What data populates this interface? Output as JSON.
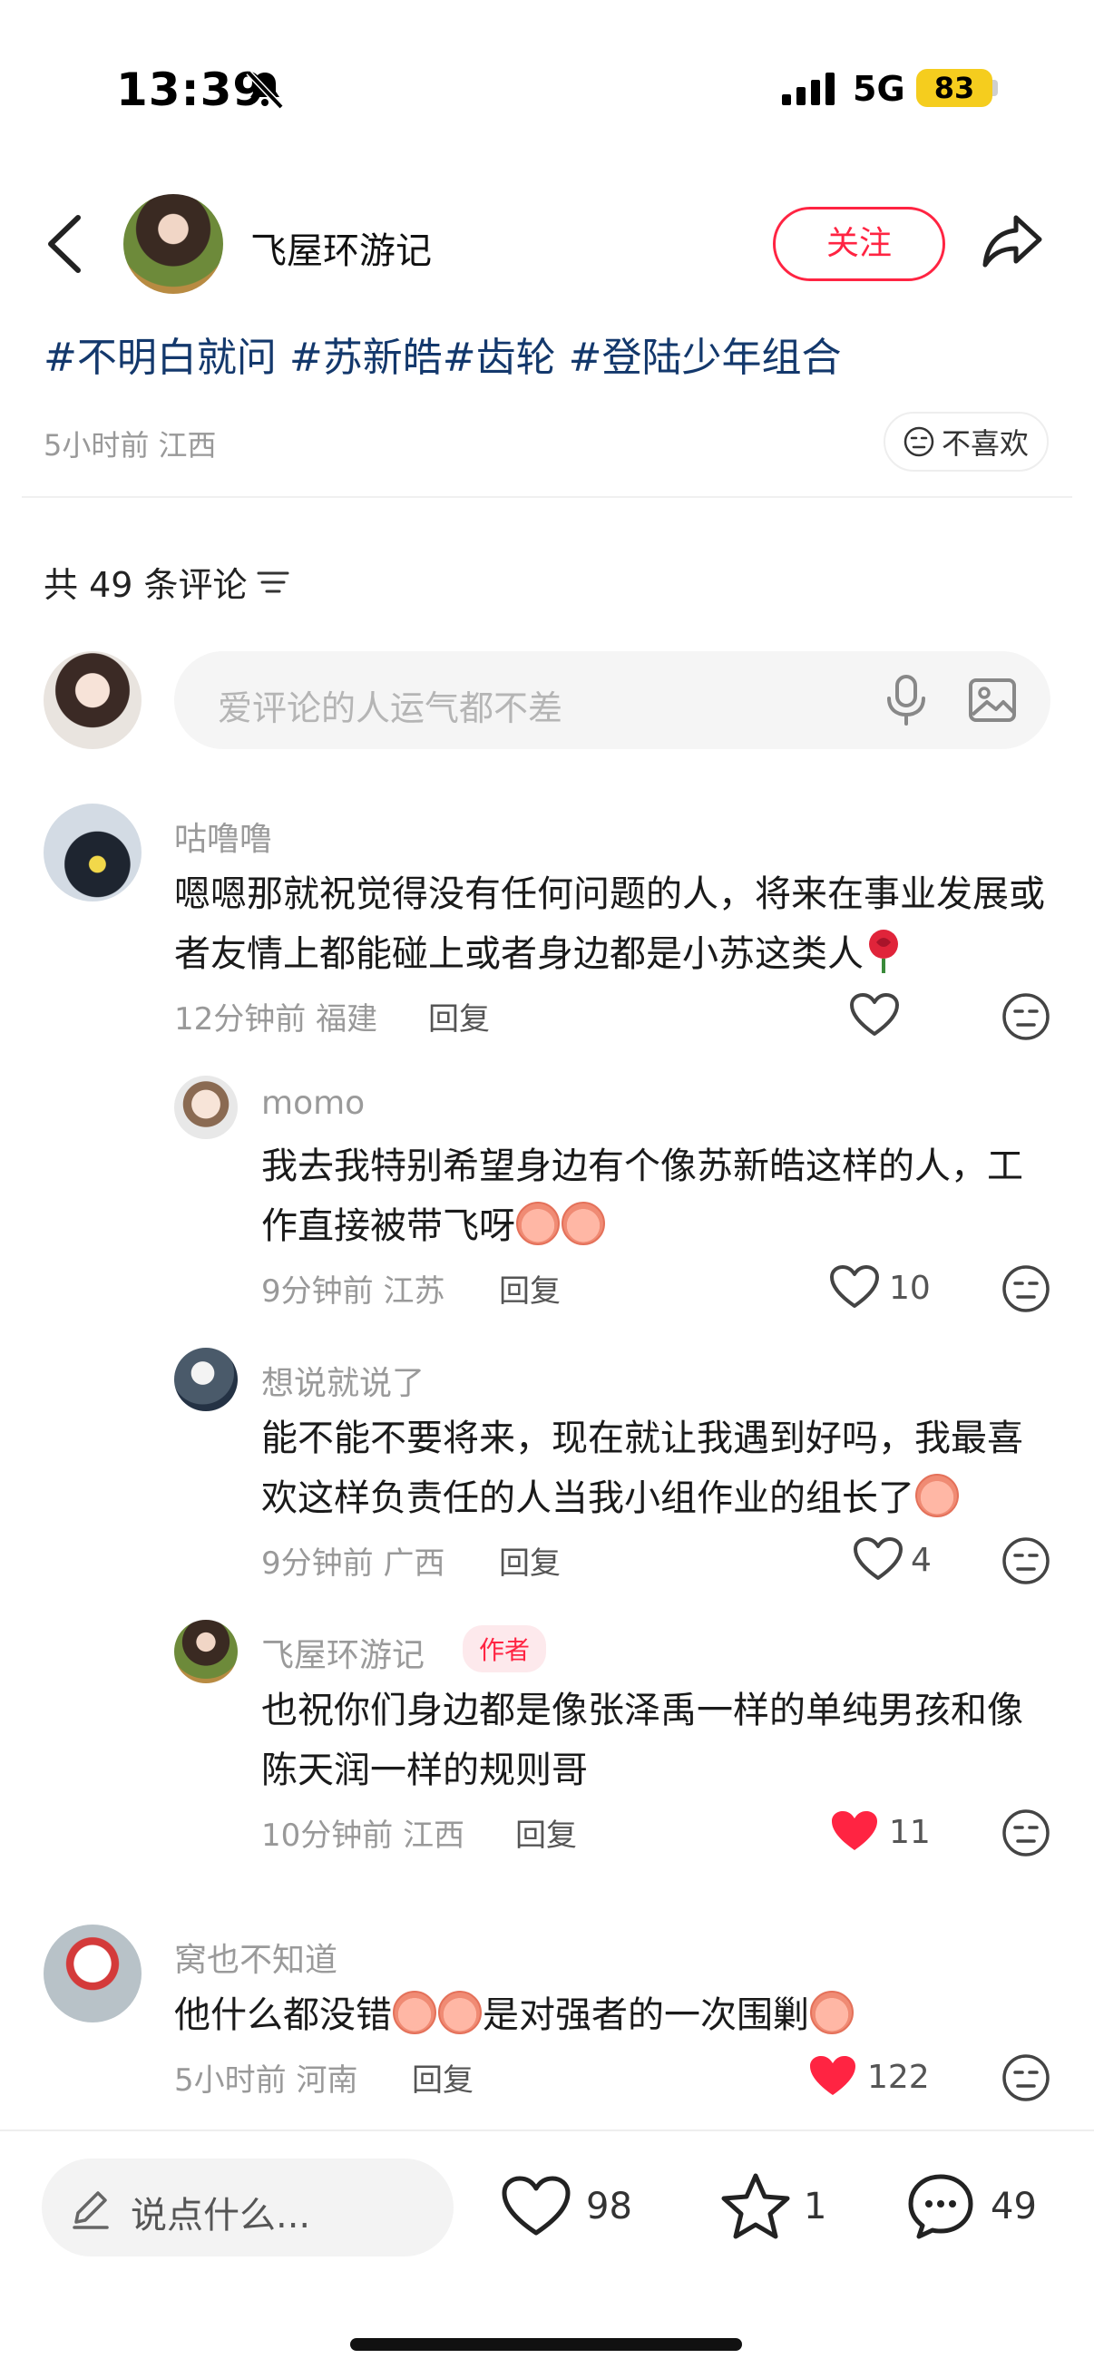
{
  "status_bar": {
    "time": "13:39",
    "network": "5G",
    "battery": "83",
    "battery_color": "#f5cd1e"
  },
  "header": {
    "author": "飞屋环游记",
    "follow_label": "关注"
  },
  "post": {
    "tags": "#不明白就问 #苏新皓#齿轮 #登陆少年组合",
    "meta": "5小时前 江西",
    "dislike_label": "不喜欢"
  },
  "comments_header": {
    "count": "共 49 条评论"
  },
  "comment_input": {
    "placeholder": "爱评论的人运气都不差"
  },
  "comments": [
    {
      "name": "咕噜噜",
      "text": "嗯嗯那就祝觉得没有任何问题的人，将来在事业发展或者友情上都能碰上或者身边都是小苏这类人",
      "meta": "12分钟前 福建",
      "reply": "回复",
      "likes": "",
      "liked": false
    },
    {
      "name": "momo",
      "text": "我去我特别希望身边有个像苏新皓这样的人，工作直接被带飞呀",
      "meta": "9分钟前 江苏",
      "reply": "回复",
      "likes": "10",
      "liked": false
    },
    {
      "name": "想说就说了",
      "text": "能不能不要将来，现在就让我遇到好吗，我最喜欢这样负责任的人当我小组作业的组长了",
      "meta": "9分钟前 广西",
      "reply": "回复",
      "likes": "4",
      "liked": false
    },
    {
      "name": "飞屋环游记",
      "badge": "作者",
      "text": "也祝你们身边都是像张泽禹一样的单纯男孩和像陈天润一样的规则哥",
      "meta": "10分钟前 江西",
      "reply": "回复",
      "likes": "11",
      "liked": true
    },
    {
      "name": "窝也不知道",
      "text_a": "他什么都没错",
      "text_b": "是对强者的一次围剿",
      "meta": "5小时前 河南",
      "reply": "回复",
      "likes": "122",
      "liked": true
    }
  ],
  "bottom_bar": {
    "input_label": "说点什么...",
    "likes": "98",
    "stars": "1",
    "comments": "49"
  },
  "colors": {
    "accent": "#ff2442",
    "tag": "#13386c"
  }
}
